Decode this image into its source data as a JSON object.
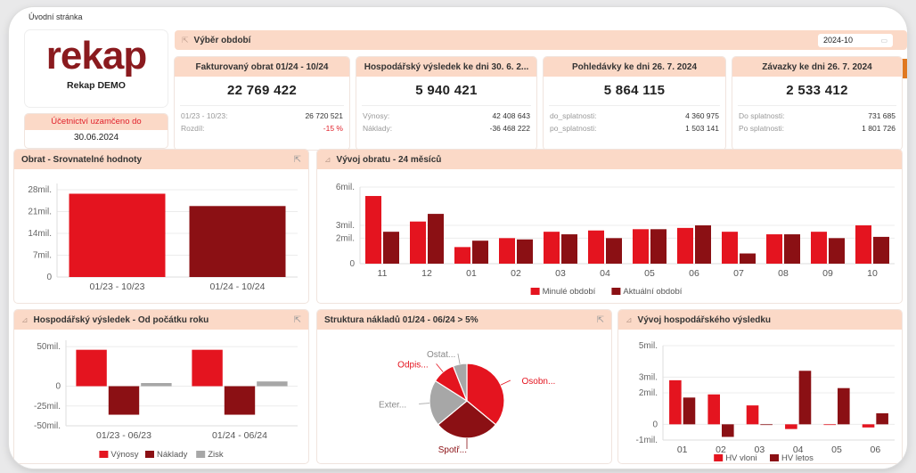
{
  "breadcrumb": "Úvodní stránka",
  "logo": {
    "word": "rekap",
    "company": "Rekap DEMO"
  },
  "lock": {
    "title": "Účetnictví uzamčeno do",
    "date": "30.06.2024"
  },
  "period": {
    "title": "Výběr období",
    "value": "2024-10",
    "icon": "calendar-icon"
  },
  "kpis": [
    {
      "title": "Fakturovaný obrat 01/24 - 10/24",
      "value": "22 769 422",
      "rows": [
        {
          "label": "01/23 - 10/23:",
          "value": "26 720 521"
        },
        {
          "label": "Rozdíl:",
          "value": "-15 %"
        }
      ]
    },
    {
      "title": "Hospodářský výsledek ke dni 30. 6. 2...",
      "value": "5 940 421",
      "rows": [
        {
          "label": "Výnosy:",
          "value": "42 408 643"
        },
        {
          "label": "Náklady:",
          "value": "-36 468 222"
        }
      ]
    },
    {
      "title": "Pohledávky ke dni 26. 7. 2024",
      "value": "5 864 115",
      "rows": [
        {
          "label": "do_splatnosti:",
          "value": "4 360 975"
        },
        {
          "label": "po_splatnosti:",
          "value": "1 503 141"
        }
      ]
    },
    {
      "title": "Závazky ke dni 26. 7. 2024",
      "value": "2 533 412",
      "rows": [
        {
          "label": "Do splatnosti:",
          "value": "731 685"
        },
        {
          "label": "Po splatnosti:",
          "value": "1 801 726"
        }
      ]
    }
  ],
  "panels": {
    "obrat": "Obrat - Srovnatelné hodnoty",
    "vyvoj": "Vývoj obratu - 24 měsíců",
    "hv": "Hospodářský výsledek - Od počátku roku",
    "struktura": "Struktura nákladů 01/24 - 06/24 > 5%",
    "vyvojhv": "Vývoj hospodářského výsledku"
  },
  "colors": {
    "red": "#e4141f",
    "dark": "#8b1014",
    "gray": "#a7a7a7",
    "header": "#fbd9c7"
  },
  "chart_data": [
    {
      "id": "obrat",
      "type": "bar",
      "categories": [
        "01/23 - 10/23",
        "01/24 - 10/24"
      ],
      "values": [
        26.72,
        22.77
      ],
      "ylim": [
        0,
        30
      ],
      "ticks": [
        0,
        7,
        14,
        21,
        28
      ],
      "tick_labels": [
        "0",
        "7mil.",
        "14mil.",
        "21mil.",
        "28mil."
      ]
    },
    {
      "id": "vyvoj",
      "type": "bar",
      "categories": [
        "11",
        "12",
        "01",
        "02",
        "03",
        "04",
        "05",
        "06",
        "07",
        "08",
        "09",
        "10"
      ],
      "series": [
        {
          "name": "Minulé období",
          "values": [
            5.3,
            3.3,
            1.3,
            2.0,
            2.5,
            2.6,
            2.7,
            2.8,
            2.5,
            2.3,
            2.5,
            3.0
          ]
        },
        {
          "name": "Aktuální období",
          "values": [
            2.5,
            3.9,
            1.8,
            1.9,
            2.3,
            2.0,
            2.7,
            3.0,
            0.8,
            2.3,
            2.0,
            2.1
          ]
        }
      ],
      "ylim": [
        0,
        6
      ],
      "ticks": [
        0,
        2,
        3,
        6
      ],
      "tick_labels": [
        "0",
        "2mil.",
        "3mil.",
        "6mil."
      ],
      "legend": "bottom"
    },
    {
      "id": "hv",
      "type": "bar",
      "categories": [
        "01/23 - 06/23",
        "01/24 - 06/24"
      ],
      "series": [
        {
          "name": "Výnosy",
          "values": [
            46,
            46
          ]
        },
        {
          "name": "Náklady",
          "values": [
            -36,
            -36
          ]
        },
        {
          "name": "Zisk",
          "values": [
            4,
            6
          ]
        }
      ],
      "ylim": [
        -50,
        58
      ],
      "ticks": [
        -50,
        -25,
        0,
        50
      ],
      "tick_labels": [
        "-50mil.",
        "-25mil.",
        "0",
        "50mil."
      ],
      "legend": "bottom"
    },
    {
      "id": "struktura",
      "type": "pie",
      "slices": [
        {
          "name": "Osobn...",
          "value": 36
        },
        {
          "name": "Spotř...",
          "value": 28
        },
        {
          "name": "Exter...",
          "value": 20
        },
        {
          "name": "Odpis...",
          "value": 10
        },
        {
          "name": "Ostat...",
          "value": 6
        }
      ]
    },
    {
      "id": "vyvojhv",
      "type": "bar",
      "categories": [
        "01",
        "02",
        "03",
        "04",
        "05",
        "06"
      ],
      "series": [
        {
          "name": "HV vloni",
          "values": [
            2.8,
            1.9,
            1.2,
            -0.3,
            0,
            -0.2
          ]
        },
        {
          "name": "HV letos",
          "values": [
            1.7,
            -0.8,
            0,
            3.4,
            2.3,
            0.7
          ]
        }
      ],
      "ylim": [
        -1,
        5
      ],
      "ticks": [
        -1,
        0,
        2,
        3,
        5
      ],
      "tick_labels": [
        "-1mil.",
        "0",
        "2mil.",
        "3mil.",
        "5mil."
      ],
      "legend": "bottom"
    }
  ]
}
